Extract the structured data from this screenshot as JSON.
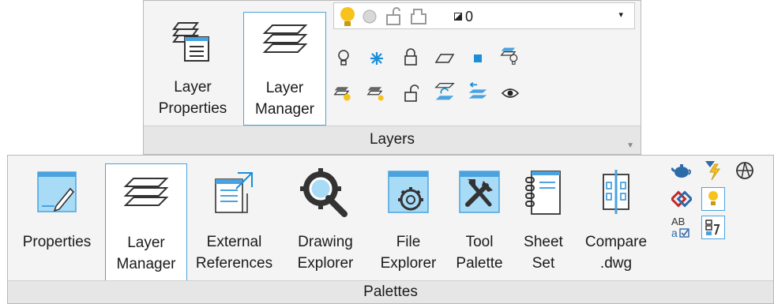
{
  "layers_panel": {
    "title": "Layers",
    "layer_properties": {
      "line1": "Layer",
      "line2": "Properties"
    },
    "layer_manager": {
      "line1": "Layer",
      "line2": "Manager"
    },
    "current_layer": {
      "name": "0"
    },
    "small_tools": [
      "bulb-off-icon",
      "freeze-icon",
      "lock-icon",
      "parallelogram-icon",
      "blue-square-icon",
      "layer-bulb-icon",
      "layer-on-icon",
      "layer-thaw-icon",
      "unlock-icon",
      "layer-refresh-icon",
      "layer-previous-icon",
      "eye-icon"
    ]
  },
  "palettes_panel": {
    "title": "Palettes",
    "buttons": [
      {
        "id": "properties",
        "line1": "Properties",
        "line2": ""
      },
      {
        "id": "layer_manager",
        "line1": "Layer",
        "line2": "Manager"
      },
      {
        "id": "external_references",
        "line1": "External",
        "line2": "References"
      },
      {
        "id": "drawing_explorer",
        "line1": "Drawing",
        "line2": "Explorer"
      },
      {
        "id": "file_explorer",
        "line1": "File",
        "line2": "Explorer"
      },
      {
        "id": "tool_palette",
        "line1": "Tool",
        "line2": "Palette"
      },
      {
        "id": "sheet_set",
        "line1": "Sheet",
        "line2": "Set"
      },
      {
        "id": "compare_dwg",
        "line1": "Compare",
        "line2": ".dwg"
      }
    ],
    "small_tools": [
      "teapot-icon",
      "lightning-icon",
      "sphere-icon",
      "link-icon",
      "light-bulb-icon",
      "ab-spell-icon",
      "attribute-icon"
    ]
  },
  "colors": {
    "accent": "#4aa3df",
    "panel_bg": "#f4f4f4",
    "footer_bg": "#e6e6e6"
  }
}
